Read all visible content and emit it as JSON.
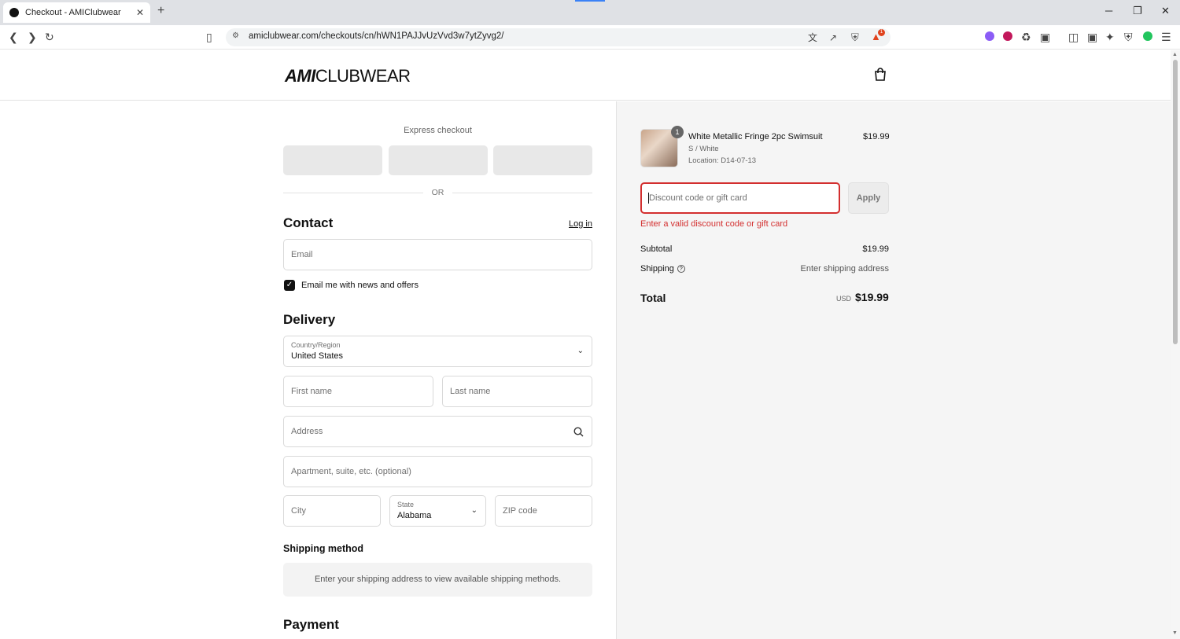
{
  "browser": {
    "tab_title": "Checkout - AMIClubwear",
    "new_tab": "+",
    "tab_close": "✕",
    "url": "amiclubwear.com/checkouts/cn/hWN1PAJJvUzVvd3w7ytZyvg2/",
    "window_controls": [
      "─",
      "❐",
      "✕"
    ],
    "notification_count": "1"
  },
  "header": {
    "logo_bold": "AMI",
    "logo_light": "CLUBWEAR"
  },
  "express": {
    "label": "Express checkout",
    "or_label": "OR"
  },
  "contact": {
    "title": "Contact",
    "login_link": "Log in",
    "email_placeholder": "Email",
    "newsletter_label": "Email me with news and offers",
    "newsletter_checked": true
  },
  "delivery": {
    "title": "Delivery",
    "country_label": "Country/Region",
    "country_value": "United States",
    "first_name_placeholder": "First name",
    "last_name_placeholder": "Last name",
    "address_placeholder": "Address",
    "apartment_placeholder": "Apartment, suite, etc. (optional)",
    "city_placeholder": "City",
    "state_label": "State",
    "state_value": "Alabama",
    "zip_placeholder": "ZIP code"
  },
  "shipping_method": {
    "title": "Shipping method",
    "message": "Enter your shipping address to view available shipping methods."
  },
  "payment": {
    "title": "Payment"
  },
  "order": {
    "quantity": "1",
    "product_name": "White Metallic Fringe 2pc Swimsuit",
    "variant": "S / White",
    "location": "Location: D14-07-13",
    "price": "$19.99",
    "discount_placeholder": "Discount code or gift card",
    "apply_label": "Apply",
    "discount_error": "Enter a valid discount code or gift card",
    "subtotal_label": "Subtotal",
    "subtotal_value": "$19.99",
    "shipping_label": "Shipping",
    "shipping_value": "Enter shipping address",
    "total_label": "Total",
    "total_currency": "USD",
    "total_value": "$19.99"
  },
  "colors": {
    "error": "#d32f2f",
    "accent_blue": "#3b82f6"
  }
}
